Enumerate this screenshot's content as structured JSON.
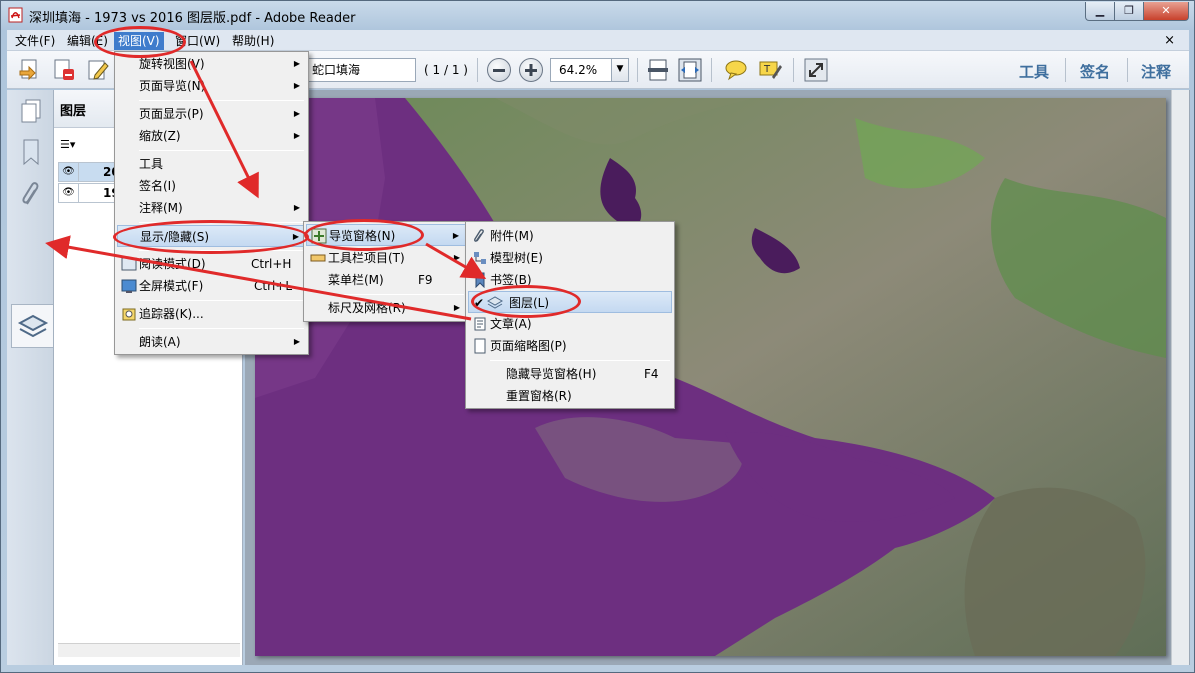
{
  "window": {
    "title": "深圳填海 - 1973 vs 2016 图层版.pdf - Adobe Reader",
    "caption_buttons": [
      "minimize",
      "restore",
      "close"
    ]
  },
  "menubar": {
    "items": [
      "文件(F)",
      "编辑(E)",
      "视图(V)",
      "窗口(W)",
      "帮助(H)"
    ],
    "active": "视图(V)",
    "close_glyph": "×"
  },
  "toolbar": {
    "filename": "蛇口填海1973.png",
    "page_indicator": "( 1 / 1 )",
    "zoom": "64.2%",
    "right_links": [
      "工具",
      "签名",
      "注释"
    ]
  },
  "layers_panel": {
    "title": "图层",
    "layers": [
      {
        "label": "20",
        "visible": true,
        "selected": true
      },
      {
        "label": "19",
        "visible": true,
        "selected": false
      }
    ]
  },
  "view_menu": {
    "items": [
      {
        "label": "旋转视图(V)",
        "submenu": true
      },
      {
        "label": "页面导览(N)",
        "submenu": true
      },
      {
        "label": "页面显示(P)",
        "submenu": true
      },
      {
        "label": "缩放(Z)",
        "submenu": true
      },
      {
        "label": "工具",
        "submenu": false
      },
      {
        "label": "签名(I)",
        "submenu": false
      },
      {
        "label": "注释(M)",
        "submenu": true
      },
      {
        "label": "显示/隐藏(S)",
        "submenu": true,
        "highlighted": true
      },
      {
        "label": "阅读模式(D)",
        "shortcut": "Ctrl+H"
      },
      {
        "label": "全屏模式(F)",
        "shortcut": "Ctrl+L"
      },
      {
        "label": "追踪器(K)..."
      },
      {
        "label": "朗读(A)",
        "submenu": true
      }
    ]
  },
  "showhide_menu": {
    "items": [
      {
        "label": "导览窗格(N)",
        "submenu": true,
        "highlighted": true
      },
      {
        "label": "工具栏项目(T)",
        "submenu": true
      },
      {
        "label": "菜单栏(M)",
        "shortcut": "F9"
      },
      {
        "label": "标尺及网格(R)",
        "submenu": true
      }
    ]
  },
  "nav_menu": {
    "items": [
      {
        "label": "附件(M)"
      },
      {
        "label": "模型树(E)"
      },
      {
        "label": "书签(B)"
      },
      {
        "label": "图层(L)",
        "checked": true,
        "highlighted": true
      },
      {
        "label": "文章(A)"
      },
      {
        "label": "页面缩略图(P)"
      },
      {
        "label": "隐藏导览窗格(H)",
        "shortcut": "F4"
      },
      {
        "label": "重置窗格(R)"
      }
    ]
  },
  "colors": {
    "highlight": "#c4d9f1",
    "menu_active": "#3f7ccc",
    "annotation_red": "#e02a2a",
    "link_blue": "#3f6f9e"
  }
}
